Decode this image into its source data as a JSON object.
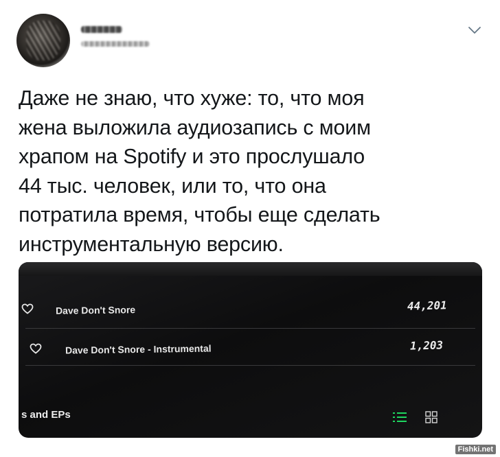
{
  "tweet": {
    "text": "Даже не знаю, что хуже: то, что моя\nжена выложила аудиозапись с моим\nхрапом на Spotify и это прослушало\n44 тыс. человек, или то, что она\nпотратила время, чтобы еще сделать\nинструментальную версию."
  },
  "photo": {
    "tracks": [
      {
        "title": "Dave Don't Snore",
        "plays": "44,201"
      },
      {
        "title": "Dave Don't Snore - Instrumental",
        "plays": "1,203"
      }
    ],
    "section_label": "s and EPs",
    "colors": {
      "background": "#111112",
      "text": "#e7e7e7",
      "divider": "#3a3a3c",
      "list_icon": "#1ed760"
    }
  },
  "watermark": "Fishki.net",
  "icons": [
    "chevron-down-icon",
    "heart-icon",
    "list-view-icon",
    "grid-view-icon"
  ]
}
